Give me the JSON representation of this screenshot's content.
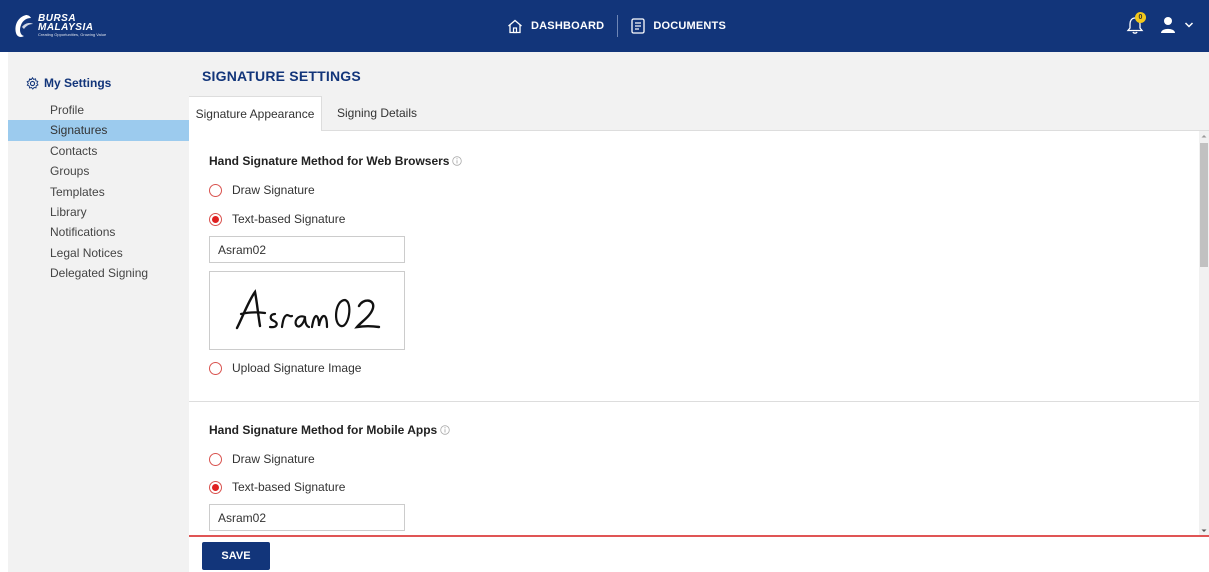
{
  "header": {
    "logo": {
      "line1": "BURSA",
      "line2": "MALAYSIA",
      "tagline": "Creating Opportunities, Growing Value"
    },
    "nav": [
      {
        "label": "DASHBOARD",
        "icon": "home-icon"
      },
      {
        "label": "DOCUMENTS",
        "icon": "document-icon"
      }
    ],
    "notifications": {
      "count": "0",
      "icon": "bell-icon"
    },
    "user": {
      "icon": "user-icon",
      "menu_icon": "chevron-down-icon"
    }
  },
  "sidebar": {
    "title": "My Settings",
    "title_icon": "gear-icon",
    "items": [
      {
        "label": "Profile",
        "active": false
      },
      {
        "label": "Signatures",
        "active": true
      },
      {
        "label": "Contacts",
        "active": false
      },
      {
        "label": "Groups",
        "active": false
      },
      {
        "label": "Templates",
        "active": false
      },
      {
        "label": "Library",
        "active": false
      },
      {
        "label": "Notifications",
        "active": false
      },
      {
        "label": "Legal Notices",
        "active": false
      },
      {
        "label": "Delegated Signing",
        "active": false
      }
    ]
  },
  "main": {
    "title": "SIGNATURE SETTINGS",
    "tabs": [
      {
        "label": "Signature Appearance",
        "active": true
      },
      {
        "label": "Signing Details",
        "active": false
      }
    ],
    "web": {
      "heading": "Hand Signature Method for Web Browsers",
      "options": {
        "draw": "Draw Signature",
        "text": "Text-based Signature",
        "upload": "Upload Signature Image"
      },
      "selected": "text",
      "text_value": "Asram02",
      "preview_text": "Asram02"
    },
    "mobile": {
      "heading": "Hand Signature Method for Mobile Apps",
      "options": {
        "draw": "Draw Signature",
        "text": "Text-based Signature"
      },
      "selected": "text",
      "text_value": "Asram02"
    }
  },
  "footer": {
    "save_label": "SAVE"
  },
  "colors": {
    "brand": "#12357a",
    "active_sidebar": "#9ccbee",
    "radio_accent": "#e02020",
    "badge": "#f2c81c"
  }
}
